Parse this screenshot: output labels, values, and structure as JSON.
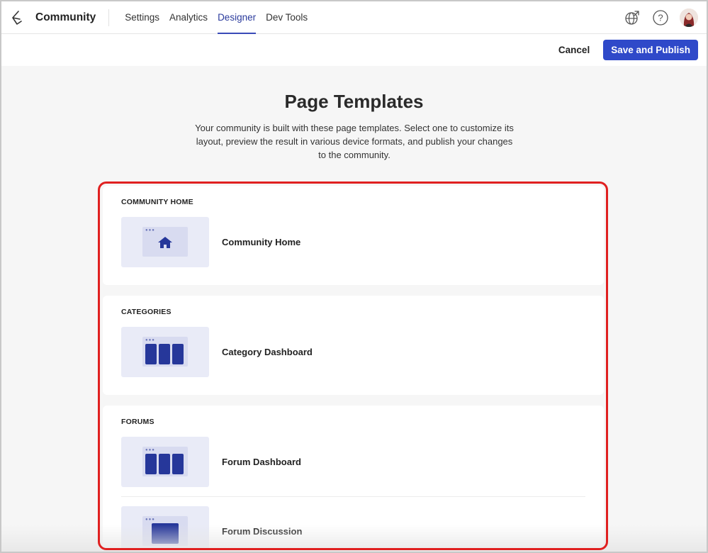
{
  "topnav": {
    "app_title": "Community",
    "tabs": [
      {
        "label": "Settings",
        "active": false
      },
      {
        "label": "Analytics",
        "active": false
      },
      {
        "label": "Designer",
        "active": true
      },
      {
        "label": "Dev Tools",
        "active": false
      }
    ],
    "icons": [
      "logo-icon",
      "globe-external-icon",
      "help-icon",
      "user-avatar"
    ]
  },
  "actionbar": {
    "cancel_label": "Cancel",
    "save_label": "Save and Publish"
  },
  "header": {
    "title": "Page Templates",
    "description": "Your community is built with these page templates. Select one to customize its layout, preview the result in various device formats, and publish your changes to the community."
  },
  "sections": [
    {
      "label": "COMMUNITY HOME",
      "templates": [
        {
          "name": "Community Home",
          "thumb": "home-icon"
        }
      ]
    },
    {
      "label": "CATEGORIES",
      "templates": [
        {
          "name": "Category Dashboard",
          "thumb": "three-columns"
        }
      ]
    },
    {
      "label": "FORUMS",
      "templates": [
        {
          "name": "Forum Dashboard",
          "thumb": "three-columns"
        },
        {
          "name": "Forum Discussion",
          "thumb": "single-block"
        }
      ]
    }
  ],
  "colors": {
    "accent": "#2f49c9",
    "highlight": "#e02020",
    "thumb_bg": "#e9ebf7",
    "thumb_block": "#26379a"
  }
}
